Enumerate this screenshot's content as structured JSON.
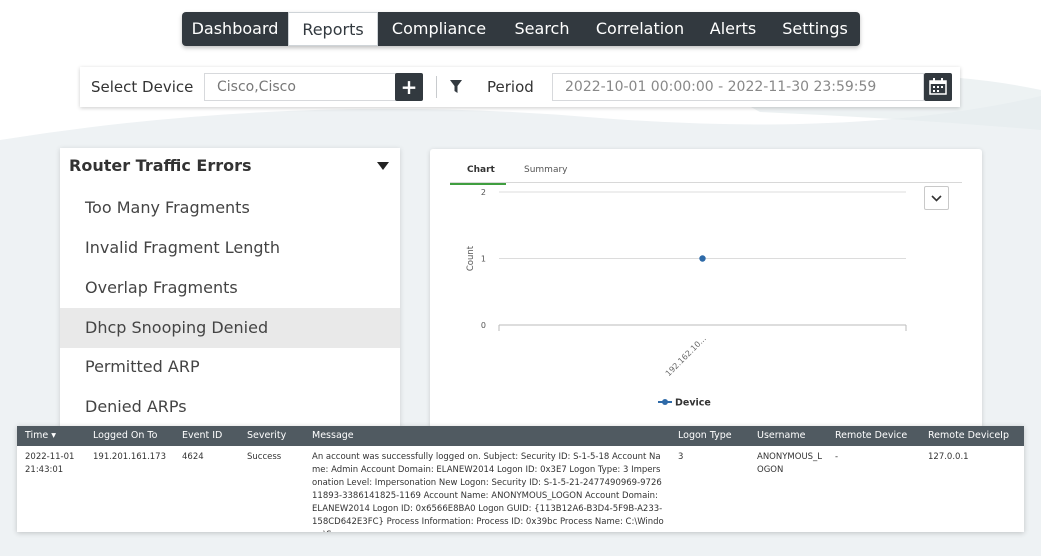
{
  "nav": {
    "items": [
      {
        "label": "Dashboard",
        "active": false
      },
      {
        "label": "Reports",
        "active": true
      },
      {
        "label": "Compliance",
        "active": false
      },
      {
        "label": "Search",
        "active": false
      },
      {
        "label": "Correlation",
        "active": false
      },
      {
        "label": "Alerts",
        "active": false
      },
      {
        "label": "Settings",
        "active": false
      }
    ]
  },
  "filter": {
    "device_label": "Select Device",
    "device_value": "Cisco,Cisco",
    "add_label": "+",
    "period_label": "Period",
    "period_value": "2022-10-01 00:00:00 - 2022-11-30 23:59:59",
    "icons": [
      "plus-icon",
      "filter-icon",
      "calendar-icon"
    ]
  },
  "report_list": {
    "title": "Router Traffic Errors",
    "items": [
      {
        "label": "Too Many Fragments",
        "selected": false
      },
      {
        "label": "Invalid Fragment Length",
        "selected": false
      },
      {
        "label": "Overlap Fragments",
        "selected": false
      },
      {
        "label": "Dhcp Snooping Denied",
        "selected": true
      },
      {
        "label": "Permitted ARP",
        "selected": false
      },
      {
        "label": "Denied ARPs",
        "selected": false
      }
    ]
  },
  "chart_panel": {
    "tabs": [
      {
        "label": "Chart",
        "active": true
      },
      {
        "label": "Summary",
        "active": false
      }
    ]
  },
  "chart_data": {
    "type": "line",
    "categories": [
      "192.162.10..."
    ],
    "series": [
      {
        "name": "Device",
        "values": [
          1
        ],
        "color": "#2e6aa8"
      }
    ],
    "ylabel": "Count",
    "yticks": [
      "0",
      "1",
      "2"
    ],
    "ylim": [
      0,
      2
    ],
    "grid": true,
    "legend": "bottom"
  },
  "table": {
    "columns": [
      "Time",
      "Logged On To",
      "Event ID",
      "Severity",
      "Message",
      "Logon Type",
      "Username",
      "Remote Device",
      "Remote DeviceIp"
    ],
    "sort_indicator": "▾",
    "rows": [
      {
        "time": "2022-11-01 21:43:01",
        "logged_on_to": "191.201.161.173",
        "event_id": "4624",
        "severity": "Success",
        "message": "An account was successfully logged on. Subject: Security ID: S-1-5-18 Account Name: Admin Account Domain: ELANEW2014 Logon ID: 0x3E7 Logon Type: 3 Impersonation Level: Impersonation New Logon: Security ID: S-1-5-21-2477490969-972611893-3386141825-1169 Account Name: ANONYMOUS_LOGON Account Domain: ELANEW2014 Logon ID: 0x6566E8BA0 Logon GUID: {113B12A6-B3D4-5F9B-A233-158CD642E3FC} Process Information: Process ID: 0x39bc Process Name: C:\\Windows\\Sy",
        "logon_type": "3",
        "username": "ANONYMOUS_LOGON",
        "remote_device": "-",
        "remote_deviceip": "127.0.0.1"
      }
    ]
  },
  "colors": {
    "nav_bg": "#32393f",
    "table_header_bg": "#505a61",
    "accent_green": "#3f9e3f",
    "series_blue": "#2e6aa8",
    "selected_row": "#e9e9e9"
  }
}
